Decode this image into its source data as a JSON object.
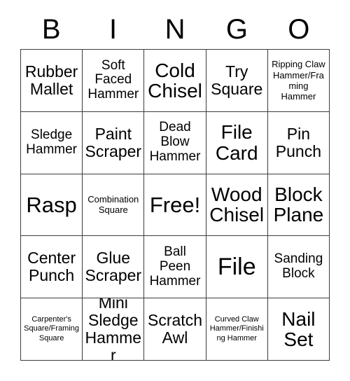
{
  "card": {
    "header_letters": [
      "B",
      "I",
      "N",
      "G",
      "O"
    ],
    "free_space_label": "Free!",
    "border_color": "#3c3c3c",
    "background_color": "#ffffff",
    "text_color": "#000000",
    "grid_size": "5x5"
  },
  "grid": {
    "rows": [
      {
        "cells": [
          {
            "label": "Rubber Mallet",
            "size": "sz-md",
            "free": false
          },
          {
            "label": "Soft Faced Hammer",
            "size": "sz-sm",
            "free": false
          },
          {
            "label": "Cold Chisel",
            "size": "sz-ml",
            "free": false
          },
          {
            "label": "Try Square",
            "size": "sz-md",
            "free": false
          },
          {
            "label": "Ripping Claw Hammer/Framing Hammer",
            "size": "sz-xs",
            "free": false
          }
        ]
      },
      {
        "cells": [
          {
            "label": "Sledge Hammer",
            "size": "sz-sm",
            "free": false
          },
          {
            "label": "Paint Scraper",
            "size": "sz-md",
            "free": false
          },
          {
            "label": "Dead Blow Hammer",
            "size": "sz-sm",
            "free": false
          },
          {
            "label": "File Card",
            "size": "sz-ml",
            "free": false
          },
          {
            "label": "Pin Punch",
            "size": "sz-md",
            "free": false
          }
        ]
      },
      {
        "cells": [
          {
            "label": "Rasp",
            "size": "sz-lg",
            "free": false
          },
          {
            "label": "Combination Square",
            "size": "sz-xs",
            "free": false
          },
          {
            "label": "Free!",
            "size": "sz-lg",
            "free": true
          },
          {
            "label": "Wood Chisel",
            "size": "sz-ml",
            "free": false
          },
          {
            "label": "Block Plane",
            "size": "sz-ml",
            "free": false
          }
        ]
      },
      {
        "cells": [
          {
            "label": "Center Punch",
            "size": "sz-md",
            "free": false
          },
          {
            "label": "Glue Scraper",
            "size": "sz-md",
            "free": false
          },
          {
            "label": "Ball Peen Hammer",
            "size": "sz-sm",
            "free": false
          },
          {
            "label": "File",
            "size": "sz-xl",
            "free": false
          },
          {
            "label": "Sanding Block",
            "size": "sz-sm",
            "free": false
          }
        ]
      },
      {
        "cells": [
          {
            "label": "Carpenter's Square/Framing Square",
            "size": "sz-xxs",
            "free": false
          },
          {
            "label": "Mini Sledge Hammer",
            "size": "sz-md",
            "free": false
          },
          {
            "label": "Scratch Awl",
            "size": "sz-md",
            "free": false
          },
          {
            "label": "Curved Claw Hammer/Finishing Hammer",
            "size": "sz-xxs",
            "free": false
          },
          {
            "label": "Nail Set",
            "size": "sz-ml",
            "free": false
          }
        ]
      }
    ]
  }
}
